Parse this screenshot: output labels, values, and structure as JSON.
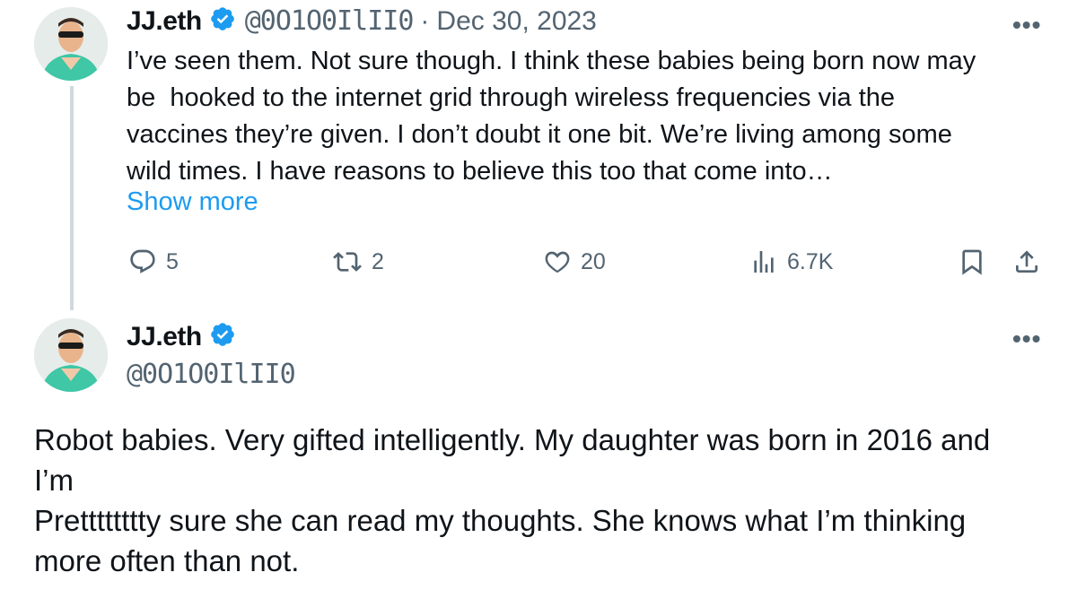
{
  "tweet1": {
    "display_name": "JJ.eth",
    "handle": "@0O1O0IlII0",
    "separator": "·",
    "date": "Dec 30, 2023",
    "more_label": "•••",
    "text_lines": [
      "I’ve seen them. Not sure though. I think these babies being born now may",
      "be  hooked to the internet grid through wireless frequencies via the",
      "vaccines they’re given. I don’t doubt it one bit. We’re living among some",
      "wild times. I have reasons to believe this too that come into…"
    ],
    "show_more": "Show more",
    "actions": {
      "replies": "5",
      "reposts": "2",
      "likes": "20",
      "views": "6.7K"
    }
  },
  "tweet2": {
    "display_name": "JJ.eth",
    "handle": "@0O1O0IlII0",
    "more_label": "•••",
    "text_lines": [
      "Robot babies. Very gifted intelligently. My daughter was born in 2016 and",
      "I’m",
      "Pretttttttty sure she can read my thoughts. She knows what I’m thinking",
      "more often than not."
    ]
  },
  "colors": {
    "accent": "#1d9bf0",
    "secondary_text": "#536471",
    "thread_line": "#cfd9de"
  },
  "icons": [
    "avatar",
    "verified-badge-icon",
    "more-icon",
    "reply-icon",
    "repost-icon",
    "like-icon",
    "views-icon",
    "bookmark-icon",
    "share-icon"
  ]
}
